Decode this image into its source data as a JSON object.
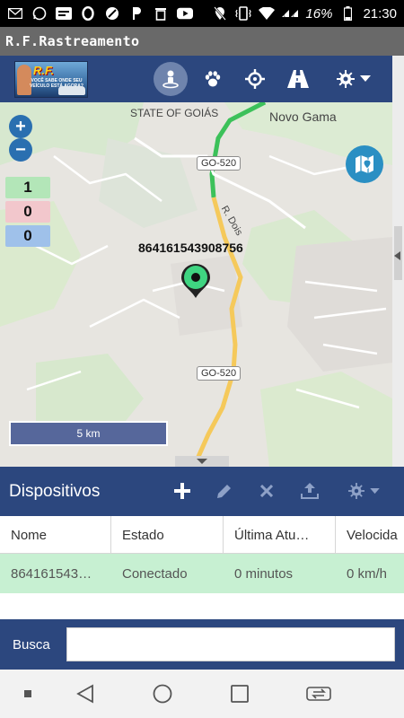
{
  "status_bar": {
    "time": "21:30",
    "battery": "16%",
    "icons": [
      "mail-icon",
      "whatsapp-icon",
      "news-icon",
      "o-icon",
      "no-icon",
      "p-icon",
      "trash-icon",
      "youtube-icon",
      "location-off-icon",
      "vibrate-icon",
      "wifi-icon",
      "signal-icon",
      "battery-icon"
    ]
  },
  "app": {
    "title": "R.F.Rastreamento"
  },
  "logo": {
    "brand": "R.F.",
    "tagline": "VOCÊ SABE ONDE SEU VEÍCULO ESTÁ AGORA?"
  },
  "toolbar": {
    "buttons": [
      "person-icon",
      "paw-icon",
      "crosshair-icon",
      "road-icon",
      "gear-icon"
    ]
  },
  "map": {
    "counts": {
      "green": "1",
      "red": "0",
      "blue": "0"
    },
    "device_label": "864161543908756",
    "scale": "5 km",
    "places": {
      "state": "STATE OF GOIÁS",
      "city": "Novo Gama",
      "street": "R. Dois"
    },
    "roads": [
      "GO-520",
      "GO-520"
    ],
    "colors": {
      "green": "#b3e6b8",
      "red": "#f2c7cc",
      "blue": "#9fc1ea"
    }
  },
  "devices_panel": {
    "title": "Dispositivos",
    "columns": [
      "Nome",
      "Estado",
      "Última Atu…",
      "Velocida"
    ],
    "rows": [
      {
        "name": "864161543…",
        "state": "Conectado",
        "last_update": "0 minutos",
        "speed": "0 km/h"
      }
    ]
  },
  "search": {
    "label": "Busca",
    "value": ""
  },
  "colors": {
    "primary": "#2c477e",
    "accent": "#2a8fc3",
    "row_highlight": "#c7f0d2"
  }
}
